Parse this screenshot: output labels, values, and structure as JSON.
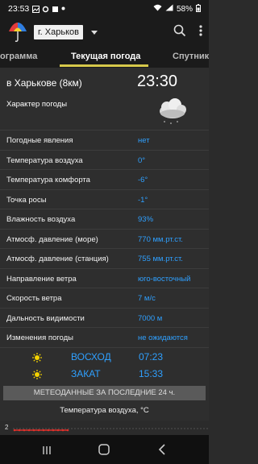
{
  "status_bar": {
    "time": "23:53",
    "battery": "58%"
  },
  "app_bar": {
    "city": "г. Харьков"
  },
  "tabs": [
    {
      "label": "ограмма"
    },
    {
      "label": "Текущая погода"
    },
    {
      "label": "Спутник"
    }
  ],
  "current": {
    "place": "в Харькове (8км)",
    "time": "23:30",
    "character_label": "Характер погоды"
  },
  "rows": [
    {
      "label": "Погодные явления",
      "value": "нет"
    },
    {
      "label": "Температура воздуха",
      "value": "0°"
    },
    {
      "label": "Температура комфорта",
      "value": "-6°"
    },
    {
      "label": "Точка росы",
      "value": "-1°"
    },
    {
      "label": "Влажность воздуха",
      "value": "93%"
    },
    {
      "label": "Атмосф. давление (море)",
      "value": "770 мм.рт.ст."
    },
    {
      "label": "Атмосф. давление (станция)",
      "value": "755 мм.рт.ст."
    },
    {
      "label": "Направление ветра",
      "value": "юго-восточный"
    },
    {
      "label": "Скорость ветра",
      "value": "7 м/с"
    },
    {
      "label": "Дальность видимости",
      "value": "7000 м"
    },
    {
      "label": "Изменения погоды",
      "value": "не ожидаются"
    }
  ],
  "sun": {
    "sunrise_label": "ВОСХОД",
    "sunrise_time": "07:23",
    "sunset_label": "ЗАКАТ",
    "sunset_time": "15:33"
  },
  "meteo": {
    "band": "МЕТЕОДАННЫЕ ЗА ПОСЛЕДНИЕ 24 ч.",
    "chart_title": "Температура воздуха, °С",
    "y_tick": "2"
  },
  "colors": {
    "value_blue": "#2fa0ff",
    "tab_indicator": "#d7c94b",
    "chart_red": "#e0302a"
  }
}
